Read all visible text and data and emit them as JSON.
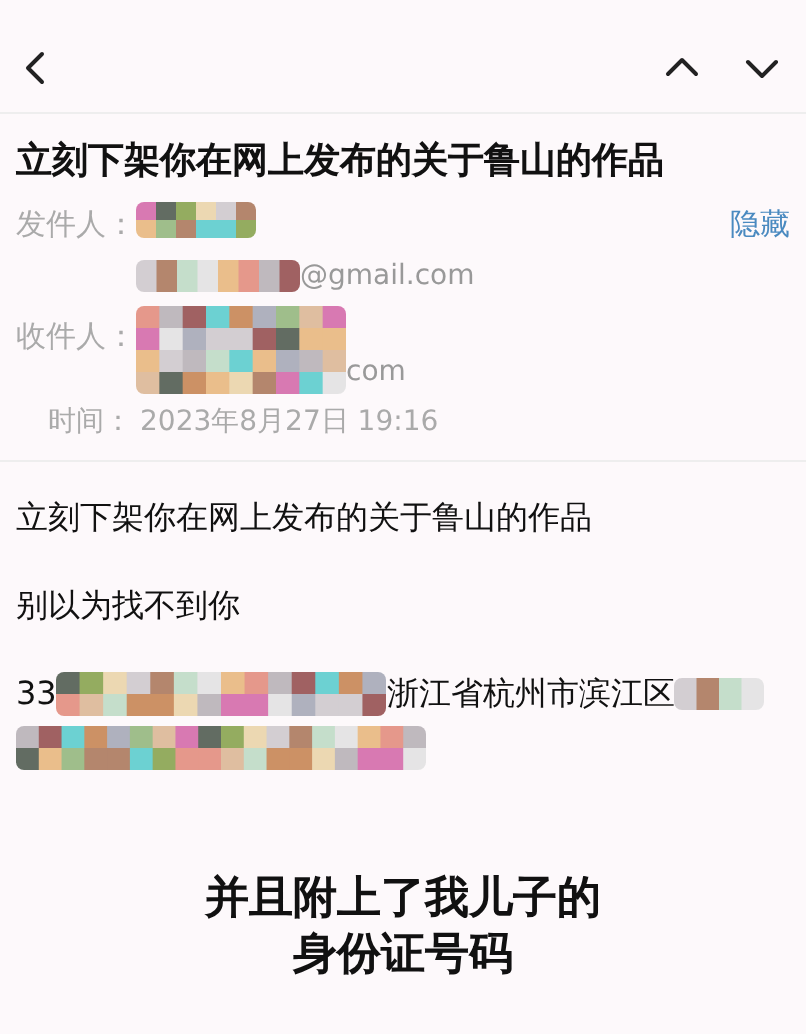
{
  "subject": "立刻下架你在网上发布的关于鲁山的作品",
  "sender": {
    "label": "发件人：",
    "address_tail": "@gmail.com"
  },
  "hide_link": "隐藏",
  "recipient": {
    "label": "收件人：",
    "address_tail": "com"
  },
  "time": {
    "label": "时间：",
    "value": "2023年8月27日 19:16"
  },
  "body": [
    {
      "kind": "line",
      "text": "立刻下架你在网上发布的关于鲁山的作品"
    },
    {
      "kind": "line",
      "text": "别以为找不到你"
    },
    {
      "kind": "redacted",
      "prefix": "33",
      "middle": "浙江省杭州市滨江区"
    }
  ],
  "caption": [
    "并且附上了我儿子的",
    "身份证号码"
  ]
}
